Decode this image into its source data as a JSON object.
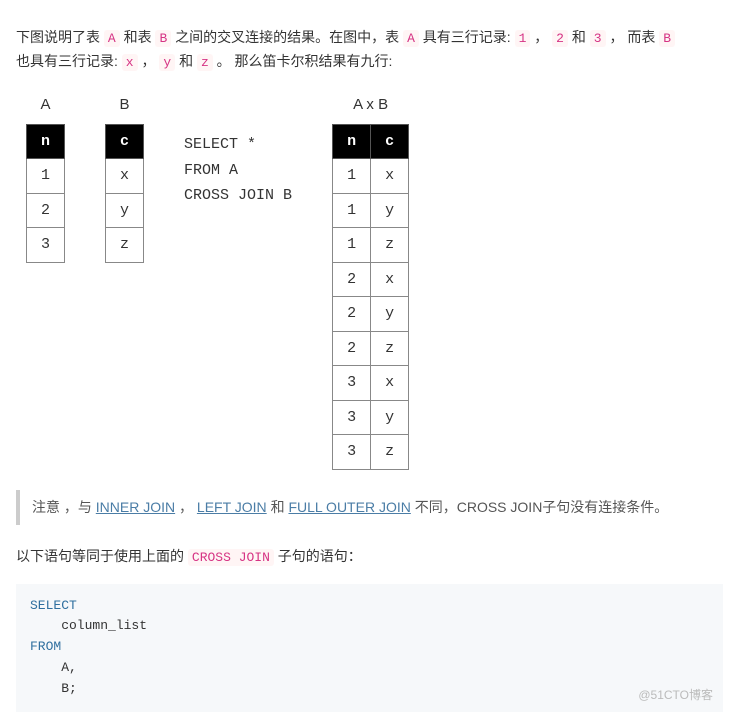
{
  "intro": {
    "p1a": "下图说明了表",
    "code1": "A",
    "p1b": "和表",
    "code2": "B",
    "p1c": "之间的交叉连接的结果。在图中，表",
    "code3": "A",
    "p1d": "具有三行记录:",
    "code4": "1",
    "comma1": "，",
    "code5": "2",
    "and1": "和",
    "code6": "3",
    "p1e": "， 而表",
    "code7": "B",
    "p2a": "也具有三行记录:",
    "code8": "x",
    "comma2": "，",
    "code9": "y",
    "and2": "和",
    "code10": "z",
    "p2b": "。 那么笛卡尔积结果有九行:"
  },
  "tables": {
    "a_title": "A",
    "b_title": "B",
    "axb_title": "A x B",
    "a_header": "n",
    "b_header": "c",
    "axb_header_n": "n",
    "axb_header_c": "c",
    "a_rows": [
      "1",
      "2",
      "3"
    ],
    "b_rows": [
      "x",
      "y",
      "z"
    ],
    "axb_rows": [
      [
        "1",
        "x"
      ],
      [
        "1",
        "y"
      ],
      [
        "1",
        "z"
      ],
      [
        "2",
        "x"
      ],
      [
        "2",
        "y"
      ],
      [
        "2",
        "z"
      ],
      [
        "3",
        "x"
      ],
      [
        "3",
        "y"
      ],
      [
        "3",
        "z"
      ]
    ]
  },
  "sql_mid": "SELECT *\nFROM A\nCROSS JOIN B",
  "note": {
    "pre": "注意 ，与",
    "link1": "INNER JOIN",
    "sep1": "，",
    "link2": "LEFT JOIN",
    "mid": "和",
    "link3": "FULL OUTER JOIN",
    "post": "不同，CROSS JOIN子句没有连接条件。"
  },
  "equiv": {
    "text1": "以下语句等同于使用上面的",
    "code": "CROSS JOIN",
    "text2": "子句的语句："
  },
  "codeblock": {
    "kw_select": "SELECT",
    "col": "    column_list",
    "kw_from": "FROM",
    "l_a": "    A,",
    "l_b": "    B;"
  },
  "watermark": "@51CTO博客"
}
